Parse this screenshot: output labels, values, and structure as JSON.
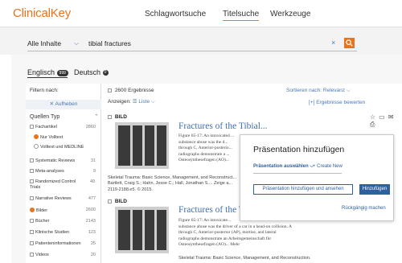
{
  "header": {
    "logo": "ClinicalKey",
    "nav": [
      "Schlagwortsuche",
      "Titelsuche",
      "Werkzeuge"
    ],
    "active_nav": "Titelsuche"
  },
  "search": {
    "scope": "Alle Inhalte",
    "query": "tibial fractures",
    "clear": "×"
  },
  "tabs": {
    "english": "Englisch",
    "english_count": "999",
    "german": "Deutsch",
    "german_count": "0"
  },
  "sidebar": {
    "filter_title": "Filtern nach:",
    "reset": "✕ Aufheben",
    "source_type": "Quellen Typ",
    "items": [
      {
        "label": "Fachartikel",
        "count": "2860",
        "type": "check"
      },
      {
        "label": "Nur Volltext",
        "count": "",
        "type": "radio-on"
      },
      {
        "label": "Volltext und MEDLINE",
        "count": "",
        "type": "radio"
      },
      {
        "label": "Systematic Reviews",
        "count": "31",
        "type": "check"
      },
      {
        "label": "Meta-analyses",
        "count": "9",
        "type": "check"
      },
      {
        "label": "Randomized Control Trials",
        "count": "49",
        "type": "check"
      },
      {
        "label": "Narrative Reviews",
        "count": "477",
        "type": "check"
      },
      {
        "label": "Bilder",
        "count": "2600",
        "type": "radio-on"
      },
      {
        "label": "Bücher",
        "count": "2143",
        "type": "check"
      },
      {
        "label": "Klinische Studien",
        "count": "123",
        "type": "check"
      },
      {
        "label": "Patienteninformationen",
        "count": "25",
        "type": "check"
      },
      {
        "label": "Videos",
        "count": "20",
        "type": "check"
      }
    ]
  },
  "results": {
    "count": "2600 Ergebnisse",
    "sort": "Sortieren nach: Relevanz",
    "show": "Anzeigen:",
    "view": "Liste",
    "rate": "[+] Ergebnisse bewerten",
    "items": [
      {
        "tag": "BILD",
        "title": "Fractures of the Tibial...",
        "lines": [
          "Figure 65-17: An intoxicated ...",
          "substance abuse was the d...",
          "through C, Anterior-posterio...",
          "radiographs demonstrate a ...",
          "Osteosynthesefragen (AO)..."
        ],
        "meta": [
          "Skeletal Trauma: Basic Science, Management, and Reconstruct...",
          "Bartlett, Craig S.; Hahn, Jesse C.; Hall, Jonathan S.... Zeige a...",
          "2119-2188.e5. © 2015."
        ]
      },
      {
        "tag": "BILD",
        "title": "Fractures of the T...",
        "lines": [
          "Figure 65-17: An intoxicate...",
          "substance abuse was the driver of a car in a head-on collision. A",
          "through C, Anterior-posterior (AP), mortise, and lateral",
          "radiographs demonstrate an Arbeitsgemeinschaft für",
          "Osteosynthesefragen (AO)... Mehr"
        ],
        "meta": [
          "Skeletal Trauma: Basic Science, Management, and Reconstruction."
        ]
      }
    ]
  },
  "modal": {
    "title": "Präsentation hinzufügen",
    "select": "Präsentation auswählen",
    "create": "+ Create New",
    "add_view": "Präsentation hinzufügen und ansehen",
    "add": "Hinzufügen",
    "undo": "Rückgängig machen"
  },
  "colors": {
    "accent": "#e8741c",
    "link": "#2f5f9c"
  }
}
